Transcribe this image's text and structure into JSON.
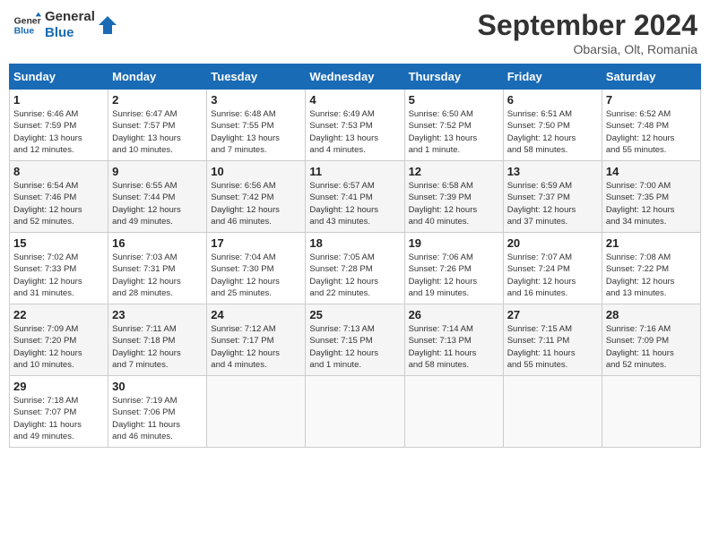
{
  "header": {
    "logo_line1": "General",
    "logo_line2": "Blue",
    "month_year": "September 2024",
    "location": "Obarsia, Olt, Romania"
  },
  "columns": [
    "Sunday",
    "Monday",
    "Tuesday",
    "Wednesday",
    "Thursday",
    "Friday",
    "Saturday"
  ],
  "weeks": [
    [
      {
        "day": "1",
        "info": "Sunrise: 6:46 AM\nSunset: 7:59 PM\nDaylight: 13 hours\nand 12 minutes."
      },
      {
        "day": "2",
        "info": "Sunrise: 6:47 AM\nSunset: 7:57 PM\nDaylight: 13 hours\nand 10 minutes."
      },
      {
        "day": "3",
        "info": "Sunrise: 6:48 AM\nSunset: 7:55 PM\nDaylight: 13 hours\nand 7 minutes."
      },
      {
        "day": "4",
        "info": "Sunrise: 6:49 AM\nSunset: 7:53 PM\nDaylight: 13 hours\nand 4 minutes."
      },
      {
        "day": "5",
        "info": "Sunrise: 6:50 AM\nSunset: 7:52 PM\nDaylight: 13 hours\nand 1 minute."
      },
      {
        "day": "6",
        "info": "Sunrise: 6:51 AM\nSunset: 7:50 PM\nDaylight: 12 hours\nand 58 minutes."
      },
      {
        "day": "7",
        "info": "Sunrise: 6:52 AM\nSunset: 7:48 PM\nDaylight: 12 hours\nand 55 minutes."
      }
    ],
    [
      {
        "day": "8",
        "info": "Sunrise: 6:54 AM\nSunset: 7:46 PM\nDaylight: 12 hours\nand 52 minutes."
      },
      {
        "day": "9",
        "info": "Sunrise: 6:55 AM\nSunset: 7:44 PM\nDaylight: 12 hours\nand 49 minutes."
      },
      {
        "day": "10",
        "info": "Sunrise: 6:56 AM\nSunset: 7:42 PM\nDaylight: 12 hours\nand 46 minutes."
      },
      {
        "day": "11",
        "info": "Sunrise: 6:57 AM\nSunset: 7:41 PM\nDaylight: 12 hours\nand 43 minutes."
      },
      {
        "day": "12",
        "info": "Sunrise: 6:58 AM\nSunset: 7:39 PM\nDaylight: 12 hours\nand 40 minutes."
      },
      {
        "day": "13",
        "info": "Sunrise: 6:59 AM\nSunset: 7:37 PM\nDaylight: 12 hours\nand 37 minutes."
      },
      {
        "day": "14",
        "info": "Sunrise: 7:00 AM\nSunset: 7:35 PM\nDaylight: 12 hours\nand 34 minutes."
      }
    ],
    [
      {
        "day": "15",
        "info": "Sunrise: 7:02 AM\nSunset: 7:33 PM\nDaylight: 12 hours\nand 31 minutes."
      },
      {
        "day": "16",
        "info": "Sunrise: 7:03 AM\nSunset: 7:31 PM\nDaylight: 12 hours\nand 28 minutes."
      },
      {
        "day": "17",
        "info": "Sunrise: 7:04 AM\nSunset: 7:30 PM\nDaylight: 12 hours\nand 25 minutes."
      },
      {
        "day": "18",
        "info": "Sunrise: 7:05 AM\nSunset: 7:28 PM\nDaylight: 12 hours\nand 22 minutes."
      },
      {
        "day": "19",
        "info": "Sunrise: 7:06 AM\nSunset: 7:26 PM\nDaylight: 12 hours\nand 19 minutes."
      },
      {
        "day": "20",
        "info": "Sunrise: 7:07 AM\nSunset: 7:24 PM\nDaylight: 12 hours\nand 16 minutes."
      },
      {
        "day": "21",
        "info": "Sunrise: 7:08 AM\nSunset: 7:22 PM\nDaylight: 12 hours\nand 13 minutes."
      }
    ],
    [
      {
        "day": "22",
        "info": "Sunrise: 7:09 AM\nSunset: 7:20 PM\nDaylight: 12 hours\nand 10 minutes."
      },
      {
        "day": "23",
        "info": "Sunrise: 7:11 AM\nSunset: 7:18 PM\nDaylight: 12 hours\nand 7 minutes."
      },
      {
        "day": "24",
        "info": "Sunrise: 7:12 AM\nSunset: 7:17 PM\nDaylight: 12 hours\nand 4 minutes."
      },
      {
        "day": "25",
        "info": "Sunrise: 7:13 AM\nSunset: 7:15 PM\nDaylight: 12 hours\nand 1 minute."
      },
      {
        "day": "26",
        "info": "Sunrise: 7:14 AM\nSunset: 7:13 PM\nDaylight: 11 hours\nand 58 minutes."
      },
      {
        "day": "27",
        "info": "Sunrise: 7:15 AM\nSunset: 7:11 PM\nDaylight: 11 hours\nand 55 minutes."
      },
      {
        "day": "28",
        "info": "Sunrise: 7:16 AM\nSunset: 7:09 PM\nDaylight: 11 hours\nand 52 minutes."
      }
    ],
    [
      {
        "day": "29",
        "info": "Sunrise: 7:18 AM\nSunset: 7:07 PM\nDaylight: 11 hours\nand 49 minutes."
      },
      {
        "day": "30",
        "info": "Sunrise: 7:19 AM\nSunset: 7:06 PM\nDaylight: 11 hours\nand 46 minutes."
      },
      {
        "day": "",
        "info": ""
      },
      {
        "day": "",
        "info": ""
      },
      {
        "day": "",
        "info": ""
      },
      {
        "day": "",
        "info": ""
      },
      {
        "day": "",
        "info": ""
      }
    ]
  ]
}
